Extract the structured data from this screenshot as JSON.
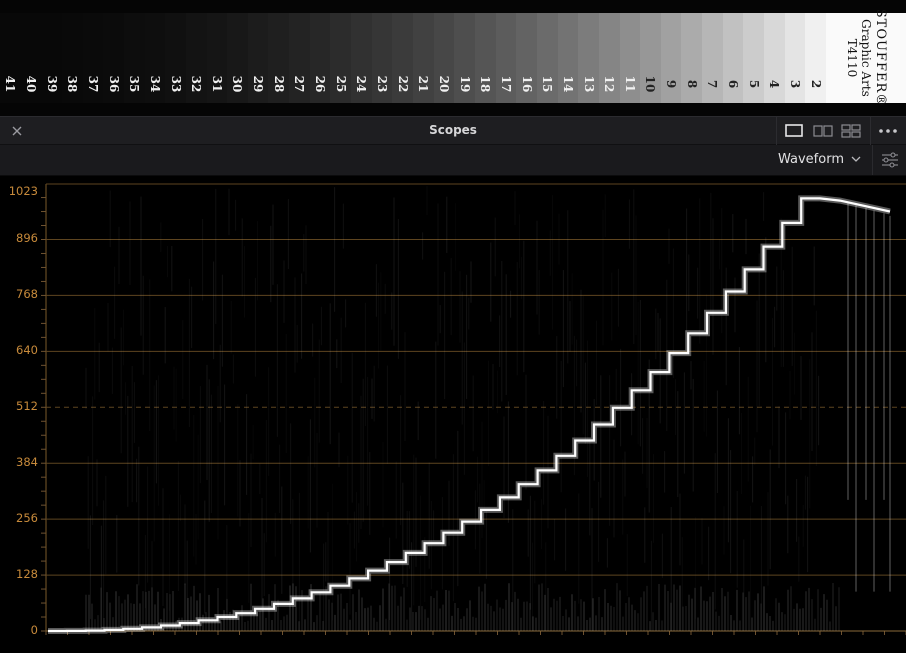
{
  "wedge": {
    "steps": [
      "41",
      "40",
      "39",
      "38",
      "37",
      "36",
      "35",
      "34",
      "33",
      "32",
      "31",
      "30",
      "29",
      "28",
      "27",
      "26",
      "25",
      "24",
      "23",
      "22",
      "21",
      "20",
      "19",
      "18",
      "17",
      "16",
      "15",
      "14",
      "13",
      "12",
      "11",
      "10",
      "9",
      "8",
      "7",
      "6",
      "5",
      "4",
      "3",
      "2"
    ],
    "logo": {
      "brand": "STOUFFER®",
      "line2": "Graphic Arts",
      "line3": "T4110"
    }
  },
  "header": {
    "title": "Scopes",
    "close_icon": "close-icon",
    "layout_icons": [
      "single-layout-icon",
      "dual-layout-icon",
      "quad-layout-icon"
    ],
    "more_icon": "more-options-icon"
  },
  "toolbar": {
    "scope_type": "Waveform",
    "dropdown_icon": "chevron-down-icon",
    "settings_icon": "settings-sliders-icon"
  },
  "scope": {
    "accent_color": "#c78a3b",
    "graticule_labels": [
      "1023",
      "896",
      "768",
      "640",
      "512",
      "384",
      "256",
      "128",
      "0"
    ],
    "graticule_values": [
      1023,
      896,
      768,
      640,
      512,
      384,
      256,
      128,
      0
    ],
    "midline_value": 512,
    "trace_color": "#ffffff"
  }
}
